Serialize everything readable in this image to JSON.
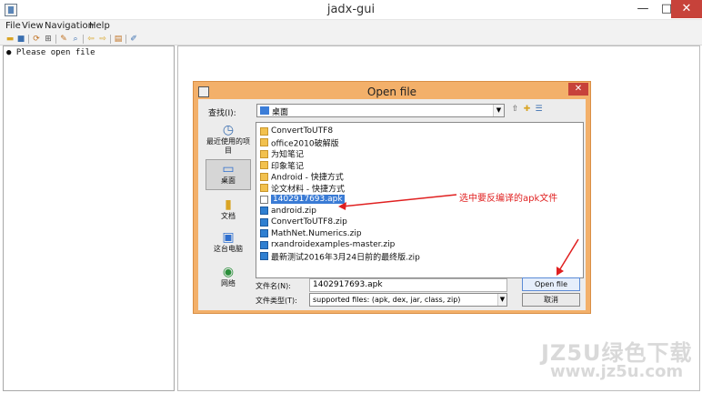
{
  "window": {
    "title": "jadx-gui",
    "min_symbol": "—",
    "max_symbol": "□",
    "close_symbol": "✕"
  },
  "menu": [
    "File",
    "View",
    "Navigation",
    "Help"
  ],
  "tree": {
    "root_label": "● Please open file"
  },
  "dialog": {
    "title": "Open file",
    "close_symbol": "✕",
    "look_in_label": "查找(I):",
    "look_in_value": "桌面",
    "places": [
      {
        "icon": "recent-icon",
        "label": "最近使用的项目"
      },
      {
        "icon": "desktop-icon",
        "label": "桌面"
      },
      {
        "icon": "documents-icon",
        "label": "文档"
      },
      {
        "icon": "computer-icon",
        "label": "这台电脑"
      },
      {
        "icon": "network-icon",
        "label": "网络"
      }
    ],
    "files": [
      {
        "name": "ConvertToUTF8",
        "type": "folder"
      },
      {
        "name": "office2010破解版",
        "type": "folder"
      },
      {
        "name": "为知笔记",
        "type": "folder"
      },
      {
        "name": "印象笔记",
        "type": "folder"
      },
      {
        "name": "Android - 快捷方式",
        "type": "folder"
      },
      {
        "name": "论文材料 - 快捷方式",
        "type": "folder"
      },
      {
        "name": "1402917693.apk",
        "type": "apk",
        "selected": true
      },
      {
        "name": "android.zip",
        "type": "zip"
      },
      {
        "name": "ConvertToUTF8.zip",
        "type": "zip"
      },
      {
        "name": "MathNet.Numerics.zip",
        "type": "zip"
      },
      {
        "name": "rxandroidexamples-master.zip",
        "type": "zip"
      },
      {
        "name": "最新测试2016年3月24日前的最终版.zip",
        "type": "zip"
      }
    ],
    "file_name_label": "文件名(N):",
    "file_name_value": "1402917693.apk",
    "file_type_label": "文件类型(T):",
    "file_type_value": "supported files: (apk, dex, jar, class, zip)",
    "open_button": "Open file",
    "cancel_button": "取消"
  },
  "annotation": "选中要反编译的apk文件",
  "watermark": {
    "main": "JZ5U绿色下载",
    "url": "www.jz5u.com"
  },
  "colors": {
    "dialog_frame": "#f3b06a",
    "close_red": "#c7423a",
    "selection_blue": "#3a7bd5",
    "annotation_red": "#e02020"
  }
}
